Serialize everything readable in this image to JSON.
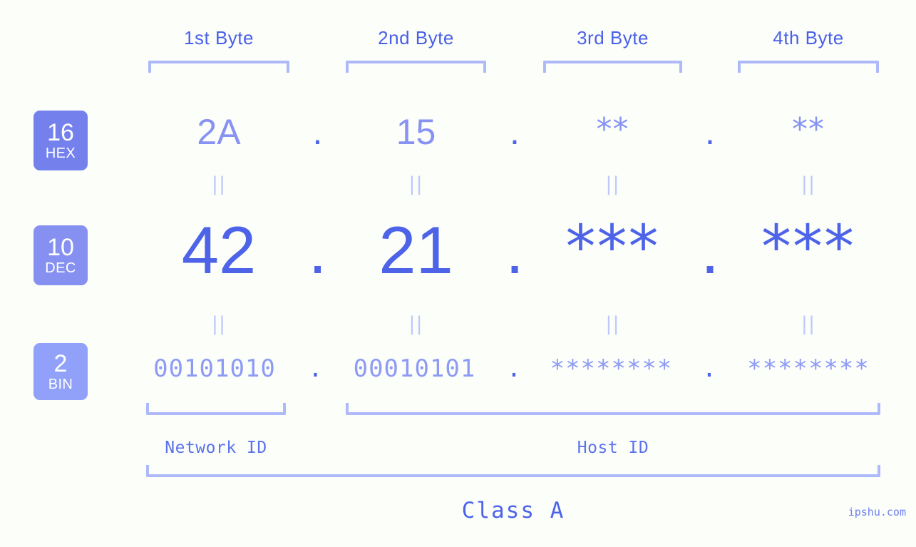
{
  "diagram": {
    "title_watermark": "ipshu.com",
    "colors": {
      "background": "#fcfefa",
      "accent_strong": "#4d63e8",
      "accent_mid": "#8590f0",
      "accent_light": "#aeb9fa",
      "badge_hex": "#7481ed",
      "badge_dec": "#8590f0",
      "badge_bin": "#91a0f8",
      "eq_mark": "#bfc8fb"
    },
    "byte_headers": [
      {
        "label": "1st Byte"
      },
      {
        "label": "2nd Byte"
      },
      {
        "label": "3rd Byte"
      },
      {
        "label": "4th Byte"
      }
    ],
    "radix_badges": [
      {
        "number": "16",
        "name": "HEX"
      },
      {
        "number": "10",
        "name": "DEC"
      },
      {
        "number": "2",
        "name": "BIN"
      }
    ],
    "rows": {
      "hex": {
        "values": [
          "2A",
          "15",
          "**",
          "**"
        ],
        "separators": [
          ".",
          ".",
          "."
        ]
      },
      "dec": {
        "values": [
          "42",
          "21",
          "***",
          "***"
        ],
        "separators": [
          ".",
          ".",
          "."
        ]
      },
      "bin": {
        "values": [
          "00101010",
          "00010101",
          "********",
          "********"
        ],
        "separators": [
          ".",
          ".",
          "."
        ]
      }
    },
    "equality_marks": [
      "||",
      "||",
      "||",
      "||",
      "||",
      "||",
      "||",
      "||"
    ],
    "segments": {
      "network_id": "Network ID",
      "host_id": "Host ID",
      "class": "Class A"
    }
  }
}
